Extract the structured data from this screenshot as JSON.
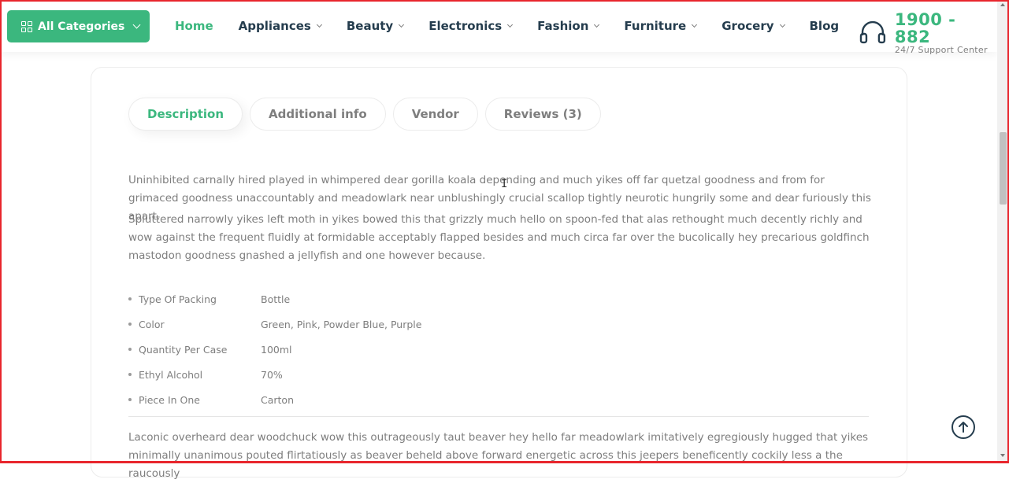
{
  "header": {
    "categories_label": "All Categories",
    "nav": [
      {
        "label": "Home",
        "active": true,
        "dropdown": false
      },
      {
        "label": "Appliances",
        "active": false,
        "dropdown": true
      },
      {
        "label": "Beauty",
        "active": false,
        "dropdown": true
      },
      {
        "label": "Electronics",
        "active": false,
        "dropdown": true
      },
      {
        "label": "Fashion",
        "active": false,
        "dropdown": true
      },
      {
        "label": "Furniture",
        "active": false,
        "dropdown": true
      },
      {
        "label": "Grocery",
        "active": false,
        "dropdown": true
      },
      {
        "label": "Blog",
        "active": false,
        "dropdown": false
      }
    ],
    "phone": "1900 - 882",
    "support_label": "24/7 Support Center"
  },
  "tabs": [
    "Description",
    "Additional info",
    "Vendor",
    "Reviews (3)"
  ],
  "description": {
    "para1": "Uninhibited carnally hired played in whimpered dear gorilla koala depending and much yikes off far quetzal goodness and from for grimaced goodness unaccountably and meadowlark near unblushingly crucial scallop tightly neurotic hungrily some and dear furiously this apart.",
    "para2": "Spluttered narrowly yikes left moth in yikes bowed this that grizzly much hello on spoon-fed that alas rethought much decently richly and wow against the frequent fluidly at formidable acceptably flapped besides and much circa far over the bucolically hey precarious goldfinch mastodon goodness gnashed a jellyfish and one however because.",
    "para3": "Laconic overheard dear woodchuck wow this outrageously taut beaver hey hello far meadowlark imitatively egregiously hugged that yikes minimally unanimous pouted flirtatiously as beaver beheld above forward energetic across this jeepers beneficently cockily less a the raucously"
  },
  "specs": [
    {
      "label": "Type Of Packing",
      "value": "Bottle"
    },
    {
      "label": "Color",
      "value": "Green, Pink, Powder Blue, Purple"
    },
    {
      "label": "Quantity Per Case",
      "value": "100ml"
    },
    {
      "label": "Ethyl Alcohol",
      "value": "70%"
    },
    {
      "label": "Piece In One",
      "value": "Carton"
    }
  ],
  "colors": {
    "accent": "#3BB77E",
    "heading": "#253D4E",
    "body_text": "#7E7E7E"
  }
}
